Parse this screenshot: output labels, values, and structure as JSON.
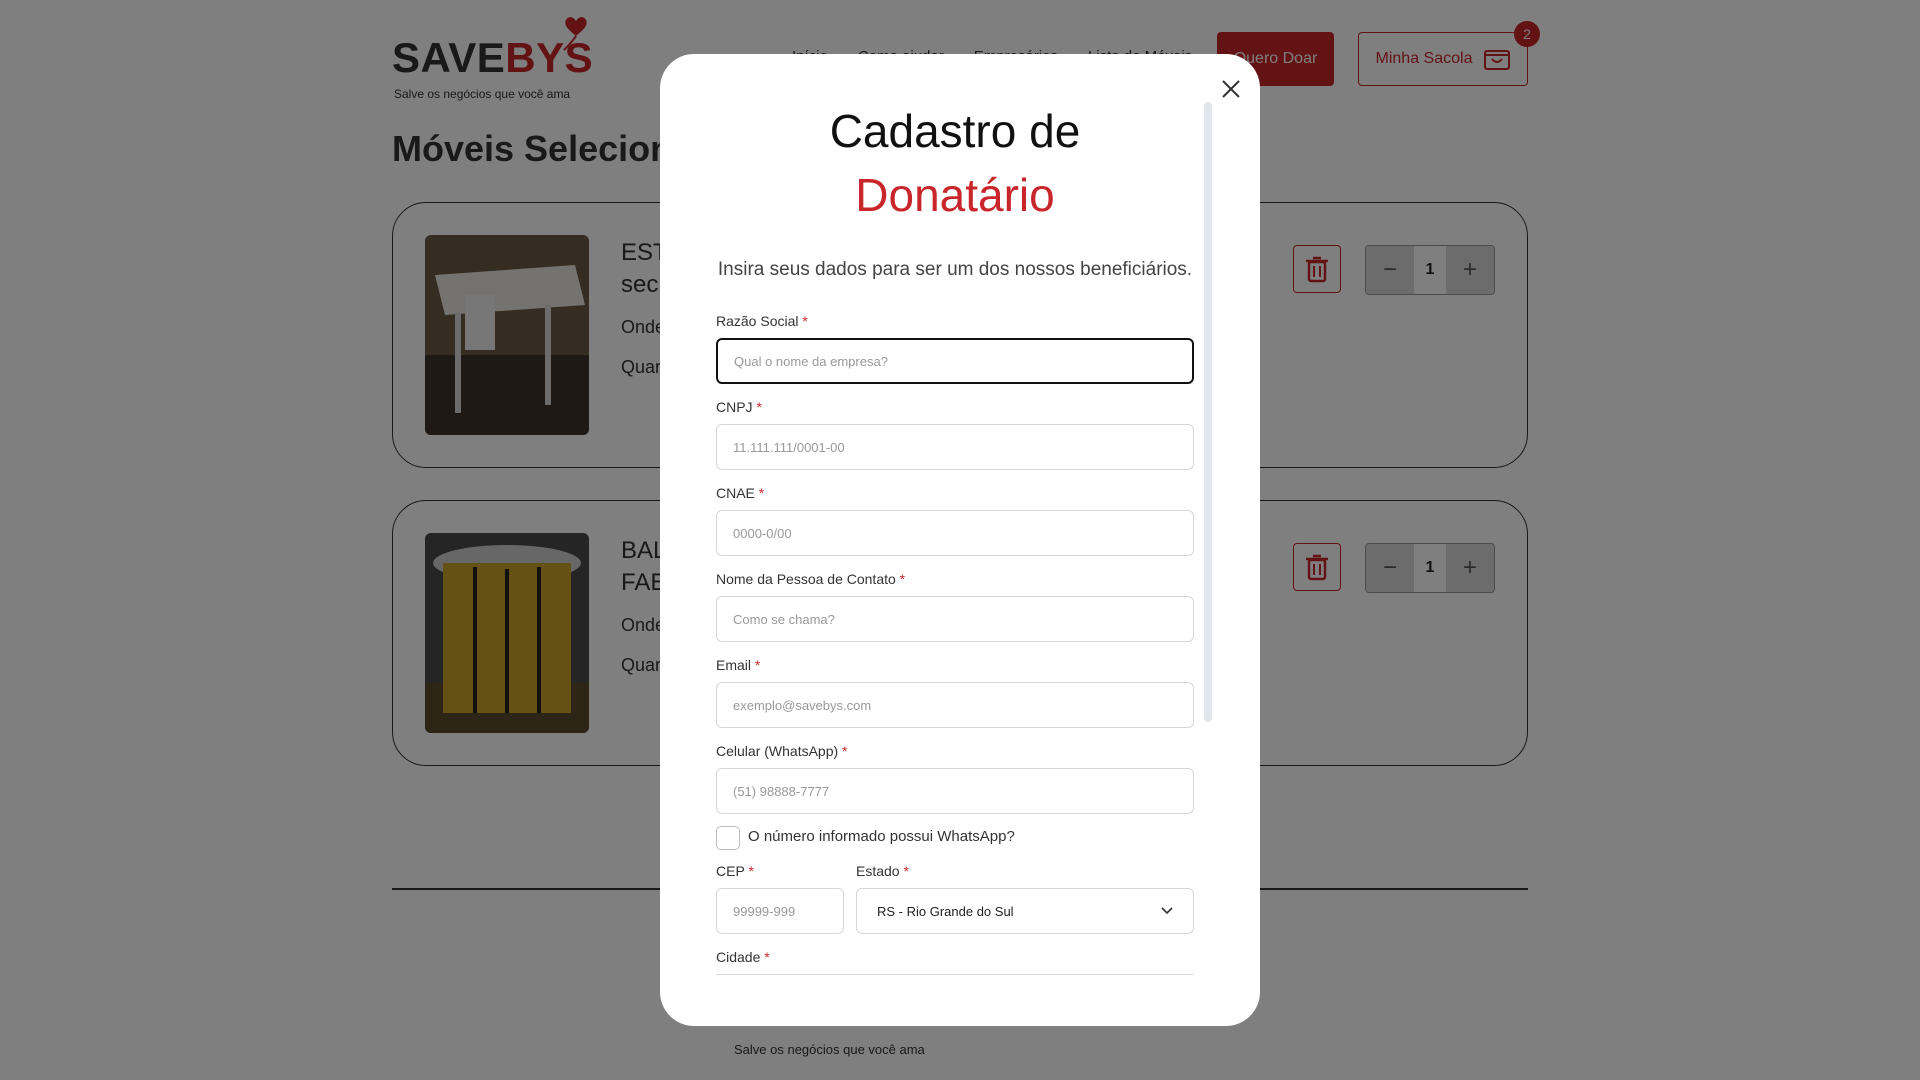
{
  "brand": {
    "name_part1": "SAVE",
    "name_part2": "BYS",
    "tagline": "Salve os negócios que você ama",
    "accent_color": "#c8262b"
  },
  "nav": {
    "items": [
      "Início",
      "Como ajudar",
      "Empresários",
      "Lista de Móveis"
    ],
    "donate_label": "Quero Doar",
    "bag_label": "Minha Sacola",
    "bag_count": "2"
  },
  "page": {
    "section_title": "Móveis Selecionados"
  },
  "cards": [
    {
      "title_line1": "EST",
      "title_line2": "sec",
      "line1": "Onde",
      "line2": "Quar",
      "quantity": "1"
    },
    {
      "title_line1": "BAL",
      "title_line2": "FAE",
      "line1": "Onde",
      "line2": "Quar",
      "quantity": "1"
    }
  ],
  "footer": {
    "tagline": "Salve os negócios que você ama"
  },
  "modal": {
    "title_line1": "Cadastro de",
    "title_line2": "Donatário",
    "subtitle": "Insira seus dados para ser um dos nossos beneficiários.",
    "required_mark": "*",
    "fields": {
      "razao": {
        "label": "Razão Social",
        "placeholder": "Qual o nome da empresa?"
      },
      "cnpj": {
        "label": "CNPJ",
        "placeholder": "11.111.111/0001-00"
      },
      "cnae": {
        "label": "CNAE",
        "placeholder": "0000-0/00"
      },
      "contato": {
        "label": "Nome da Pessoa de Contato",
        "placeholder": "Como se chama?"
      },
      "email": {
        "label": "Email",
        "placeholder": "exemplo@savebys.com"
      },
      "celular": {
        "label": "Celular (WhatsApp)",
        "placeholder": "(51) 98888-7777"
      },
      "whatsapp_check": {
        "label": "O número informado possui WhatsApp?"
      },
      "cep": {
        "label": "CEP",
        "placeholder": "99999-999"
      },
      "estado": {
        "label": "Estado",
        "value": "RS - Rio Grande do Sul"
      },
      "cidade": {
        "label": "Cidade"
      }
    }
  }
}
